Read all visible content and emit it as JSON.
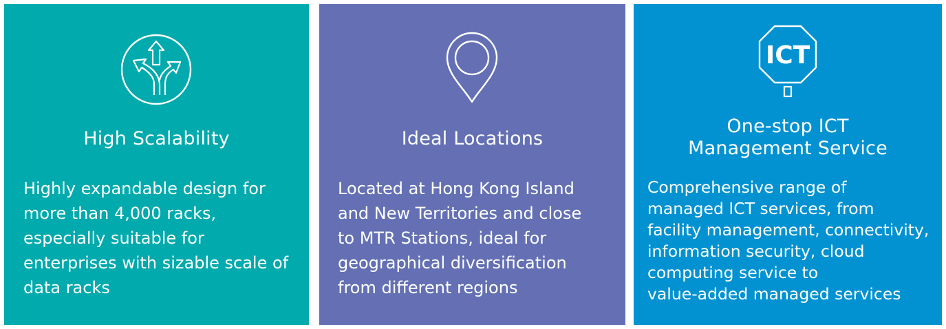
{
  "cards": [
    {
      "title": "High Scalability",
      "description": "Highly expandable design for\nmore than 4,000 racks,\nespecially suitable for\nenterprises with sizable scale of\ndata racks",
      "icon": "diverging-arrows-icon",
      "color": "#00aaad"
    },
    {
      "title": "Ideal Locations",
      "description": "Located at Hong Kong Island\nand New Territories and close\nto MTR Stations, ideal for\ngeographical diversification\nfrom different regions",
      "icon": "map-pin-icon",
      "color": "#6470b3"
    },
    {
      "title": "One-stop ICT\nManagement Service",
      "description": "Comprehensive range of\nmanaged ICT services, from\nfacility management, connectivity,\ninformation security, cloud\ncomputing service to\nvalue-added managed services",
      "icon": "ict-sign-icon",
      "icon_text": "ICT",
      "color": "#0392d1"
    }
  ]
}
